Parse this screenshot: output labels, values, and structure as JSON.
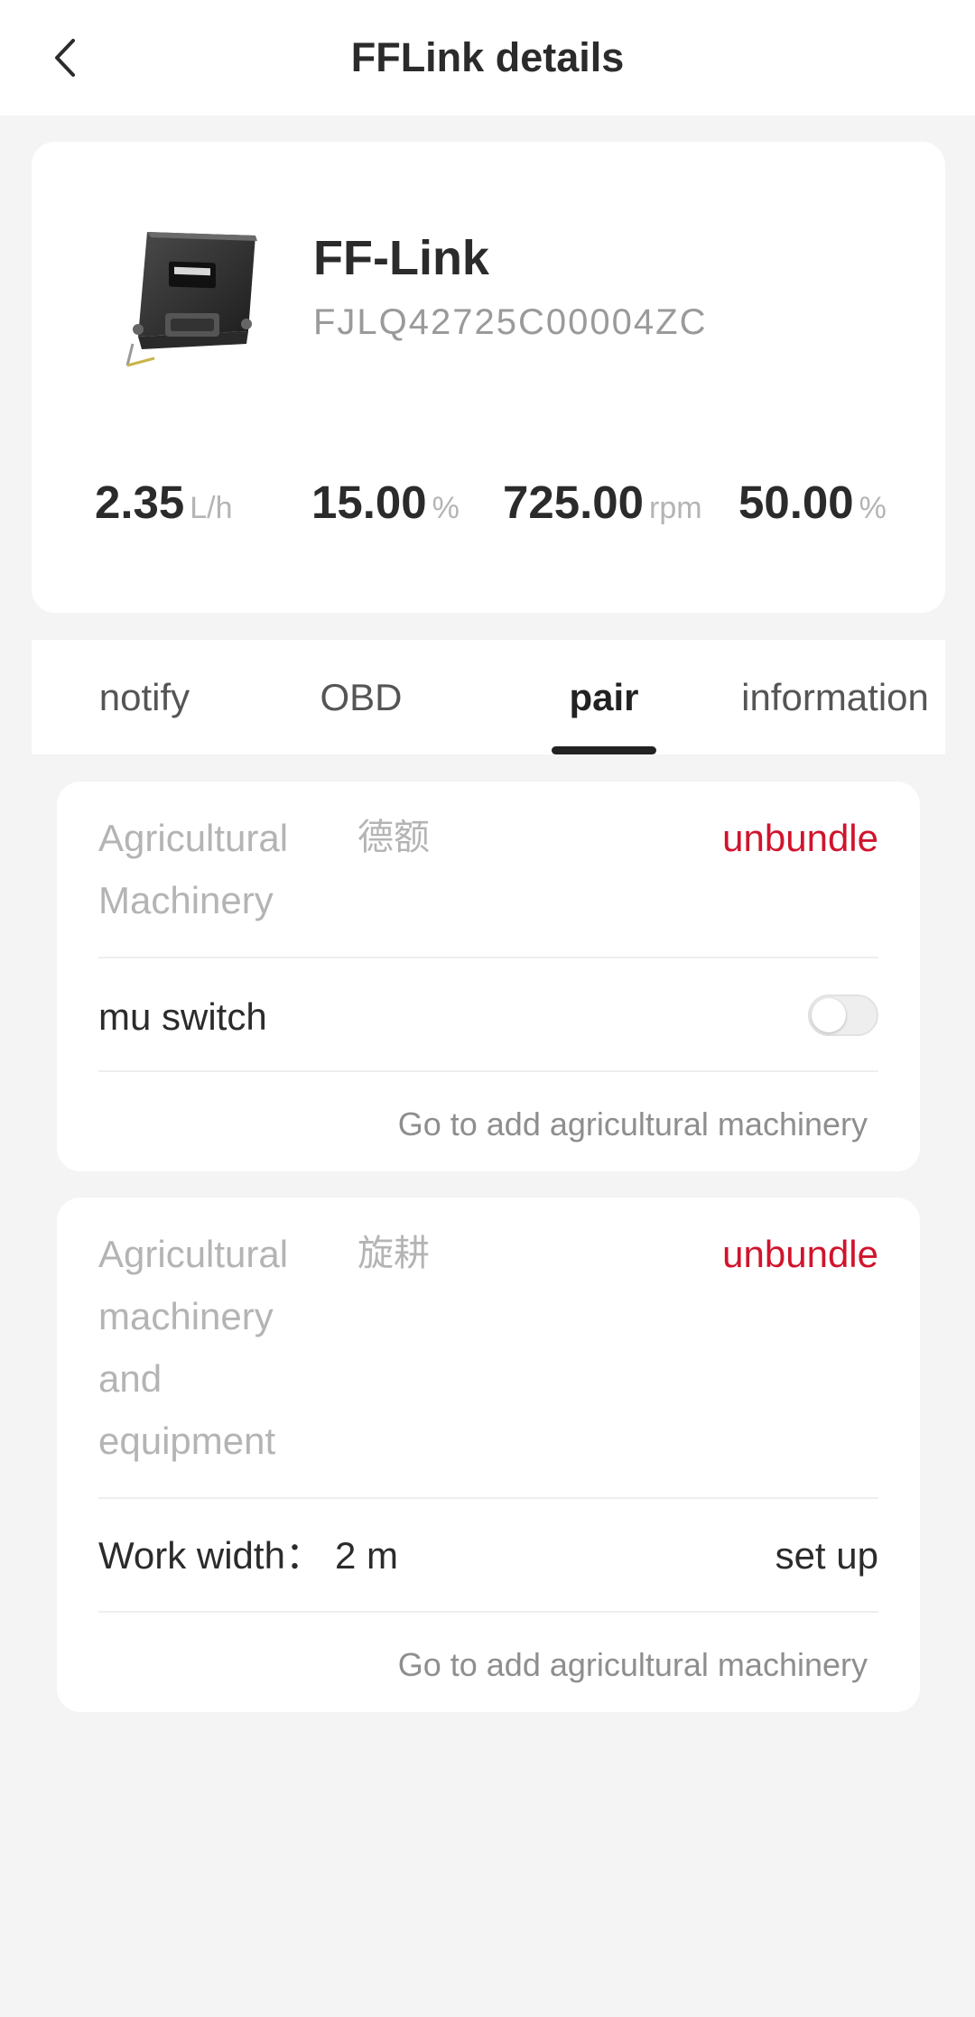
{
  "header": {
    "title": "FFLink details",
    "back_icon": "chevron-left-icon"
  },
  "device": {
    "image_icon": "fflink-device-image",
    "name": "FF-Link",
    "serial": "FJLQ42725C00004ZC",
    "metrics": [
      {
        "value": "2.35",
        "unit": "L/h"
      },
      {
        "value": "15.00",
        "unit": "%"
      },
      {
        "value": "725.00",
        "unit": "rpm"
      },
      {
        "value": "50.00",
        "unit": "%"
      }
    ]
  },
  "tabs": [
    {
      "label": "notify",
      "active": false
    },
    {
      "label": "OBD",
      "active": false
    },
    {
      "label": "pair",
      "active": true
    },
    {
      "label": "information",
      "active": false
    }
  ],
  "machinery_card": {
    "label": "Agricultural Machinery",
    "label_lines": [
      "Agricultural",
      "Machinery"
    ],
    "value": "德额",
    "unbundle": "unbundle",
    "switch_label": "mu switch",
    "switch_on": false,
    "add_link": "Go to add agricultural machinery"
  },
  "equipment_card": {
    "label": "Agricultural machinery and equipment",
    "label_lines": [
      "Agricultural",
      "machinery",
      "and",
      "equipment"
    ],
    "value": "旋耕",
    "unbundle": "unbundle",
    "work_width_label": "Work width：",
    "work_width_value": "2 m",
    "setup_label": "set up",
    "add_link": "Go to add agricultural machinery"
  },
  "colors": {
    "accent_red": "#d0142c",
    "text_dark": "#2b2b2b",
    "text_muted": "#b4b4b4",
    "background": "#f4f4f4"
  }
}
